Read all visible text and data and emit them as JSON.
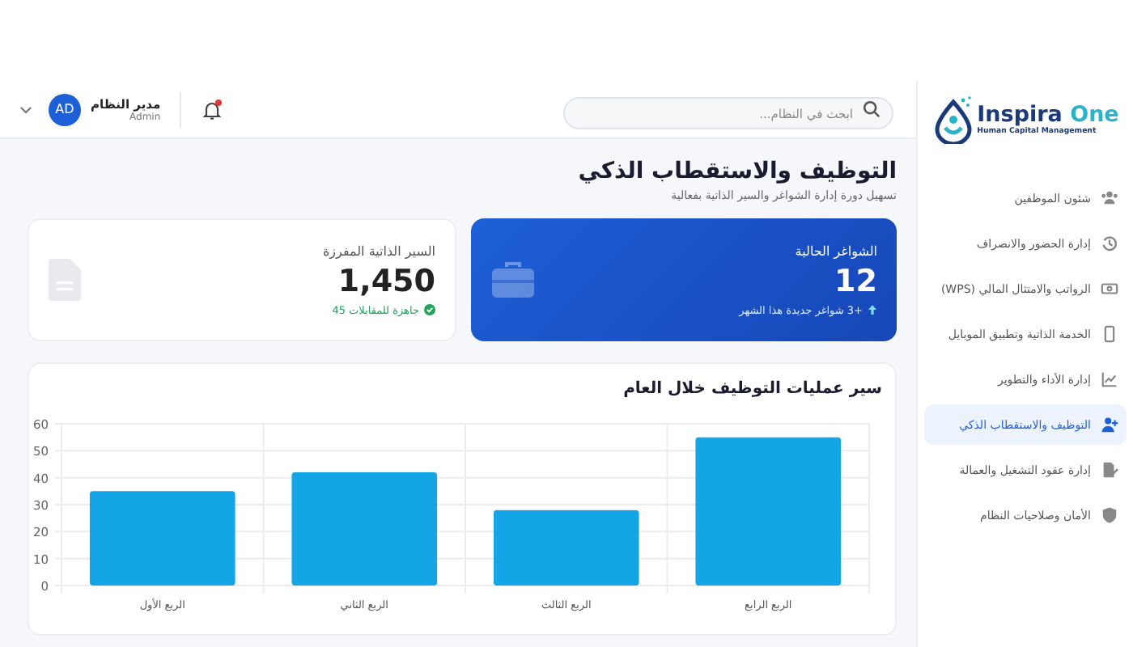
{
  "logo": {
    "name_a": "Inspira",
    "name_b": "One",
    "tagline": "Human Capital Management"
  },
  "sidebar": {
    "items": [
      {
        "label": "شئون الموظفين",
        "selected": false
      },
      {
        "label": "إدارة الحضور والانصراف",
        "selected": false
      },
      {
        "label": "الرواتب والامتثال المالي (WPS)",
        "selected": false
      },
      {
        "label": "الخدمة الذاتية وتطبيق الموبايل",
        "selected": false
      },
      {
        "label": "إدارة الأداء والتطوير",
        "selected": false
      },
      {
        "label": "التوظيف والاستقطاب الذكي",
        "selected": true
      },
      {
        "label": "إدارة عقود التشغيل والعمالة",
        "selected": false
      },
      {
        "label": "الأمان وصلاحيات النظام",
        "selected": false
      }
    ]
  },
  "header": {
    "search": {
      "placeholder": "ابحث في النظام..."
    },
    "notifications": {
      "unread": true
    },
    "user": {
      "initials": "AD",
      "name": "مدير النظام",
      "role": "Admin"
    }
  },
  "page": {
    "title": "التوظيف والاستقطاب الذكي",
    "subtitle": "تسهيل دورة إدارة الشواغر والسير الذاتية بفعالية"
  },
  "stats": [
    {
      "kind": "primary",
      "label": "الشواغر الحالية",
      "value": "12",
      "note": "+3 شواغر جديدة هذا الشهر"
    },
    {
      "kind": "plain",
      "label": "السير الذاتية المفرزة",
      "value": "1,450",
      "note": "جاهزة للمقابلات 45"
    }
  ],
  "chart_card": {
    "title": "سير عمليات التوظيف خلال العام",
    "chart_data": {
      "type": "bar",
      "categories": [
        "الربع الأول",
        "الربع الثاني",
        "الربع الثالث",
        "الربع الرابع"
      ],
      "series": [
        {
          "color": "#14a5e6",
          "values": [
            35,
            42,
            28,
            55
          ]
        }
      ],
      "ylim": [
        0,
        60
      ],
      "yticks": [
        0,
        10,
        20,
        30,
        40,
        50,
        60
      ],
      "grid": true
    }
  }
}
